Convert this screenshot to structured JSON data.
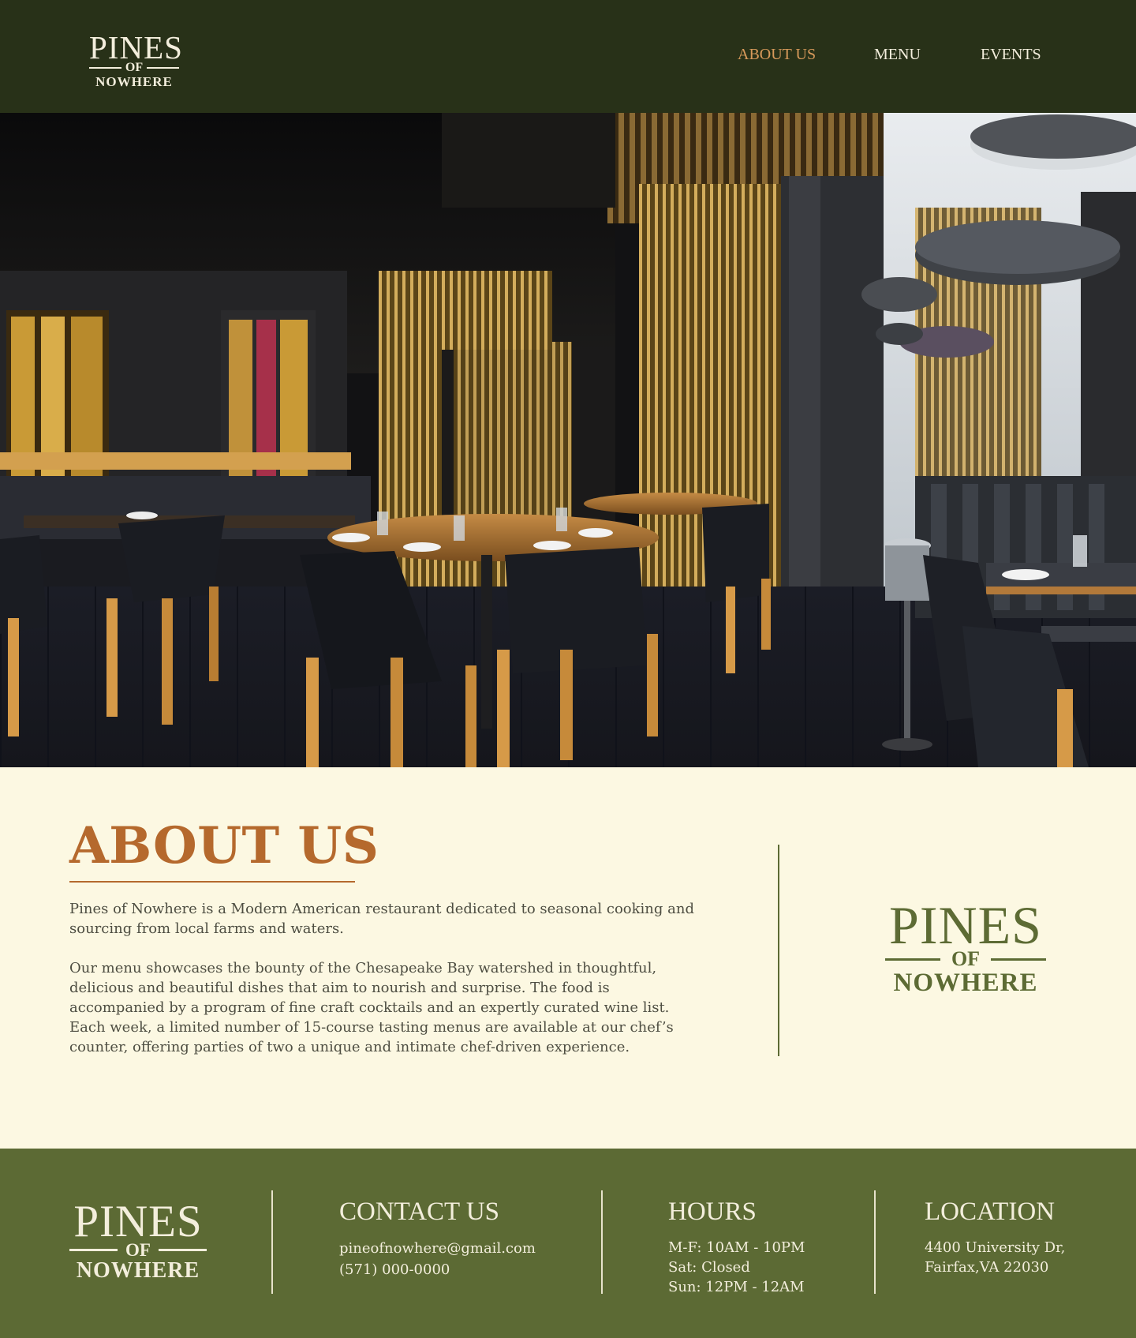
{
  "brand": {
    "logo_top": "PINES",
    "logo_mid": "OF",
    "logo_bottom": "NOWHERE"
  },
  "nav": {
    "items": [
      {
        "label": "ABOUT US",
        "active": true
      },
      {
        "label": "MENU",
        "active": false
      },
      {
        "label": "EVENTS",
        "active": false
      }
    ]
  },
  "hero": {
    "image_description": "restaurant-interior-photo"
  },
  "about": {
    "title": "ABOUT US",
    "paragraph1": "Pines of Nowhere is a Modern American restaurant dedicated to seasonal cooking and sourcing from local farms and waters.",
    "paragraph2": "Our menu showcases the bounty of the Chesapeake Bay watershed in thoughtful, delicious and beautiful dishes that aim to nourish and surprise. The food is accompanied by a program of fine craft cocktails and an expertly curated wine list. Each week, a limited number of 15-course tasting menus are available at our chef’s counter, offering parties of two a unique and intimate chef-driven experience."
  },
  "footer": {
    "contact": {
      "heading": "CONTACT US",
      "email": "pineofnowhere@gmail.com",
      "phone": "(571) 000-0000"
    },
    "hours": {
      "heading": "HOURS",
      "weekdays": "M-F: 10AM - 10PM",
      "saturday": "Sat: Closed",
      "sunday": "Sun: 12PM - 12AM"
    },
    "location": {
      "heading": "LOCATION",
      "line1": "4400 University Dr,",
      "line2": "Fairfax,VA 22030"
    }
  },
  "colors": {
    "header_bg": "#283118",
    "nav_active": "#d89a5b",
    "page_bg": "#fcf8e2",
    "accent_orange": "#b5692d",
    "olive": "#5d6b34",
    "footer_bg": "#5c6a34",
    "cream_text": "#f3eedc"
  }
}
